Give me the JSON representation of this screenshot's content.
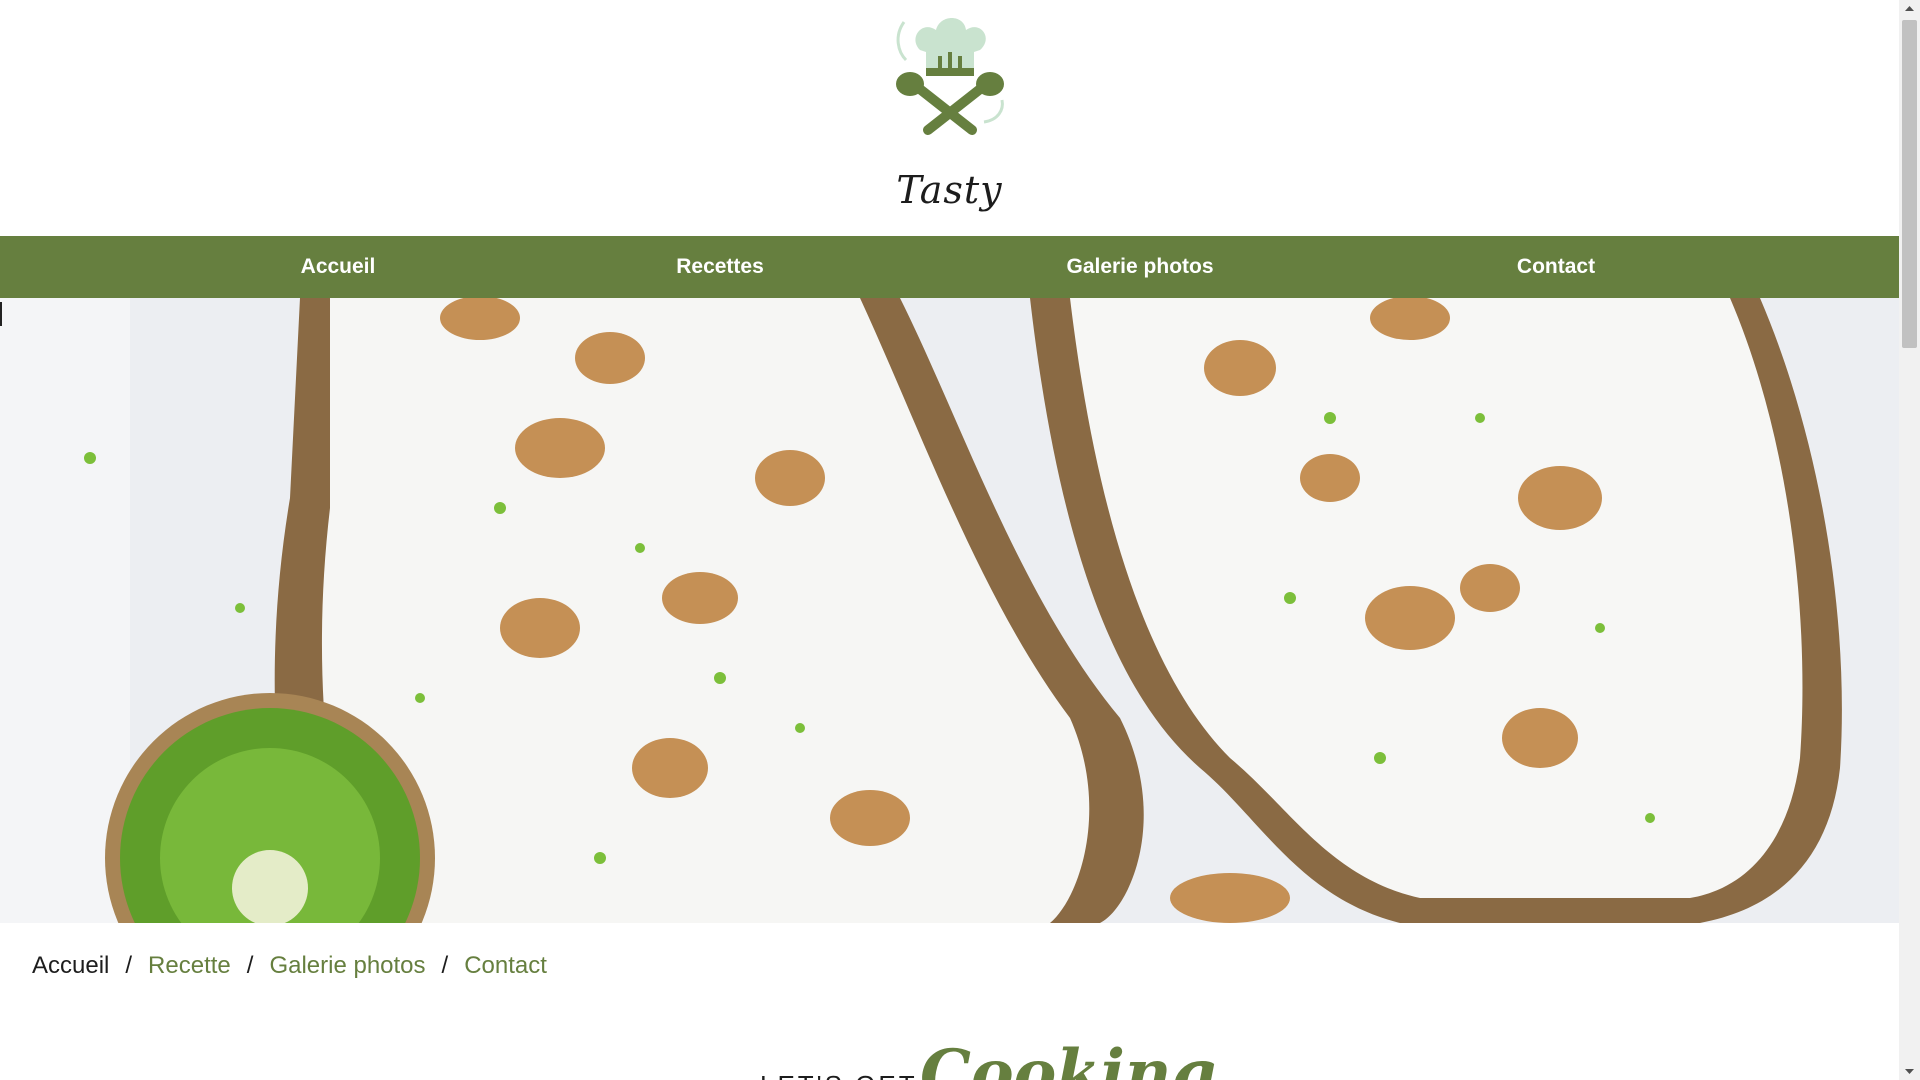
{
  "brand": {
    "name": "Tasty"
  },
  "nav": {
    "items": [
      {
        "label": "Accueil"
      },
      {
        "label": "Recettes"
      },
      {
        "label": "Galerie photos"
      },
      {
        "label": "Contact"
      }
    ]
  },
  "breadcrumb": {
    "current": "Accueil",
    "links": [
      "Recette",
      "Galerie photos",
      "Contact"
    ],
    "separator": "/"
  },
  "section": {
    "lead": "LET'S GET",
    "script": "Cooking"
  },
  "colors": {
    "accent": "#667f3f",
    "logo_light": "#c9e3cf",
    "text": "#1d1d1d"
  },
  "icons": {
    "logo": "chef-hat-spoons-logo",
    "scroll_up": "scroll-up-arrow-icon",
    "scroll_down": "scroll-down-arrow-icon"
  }
}
